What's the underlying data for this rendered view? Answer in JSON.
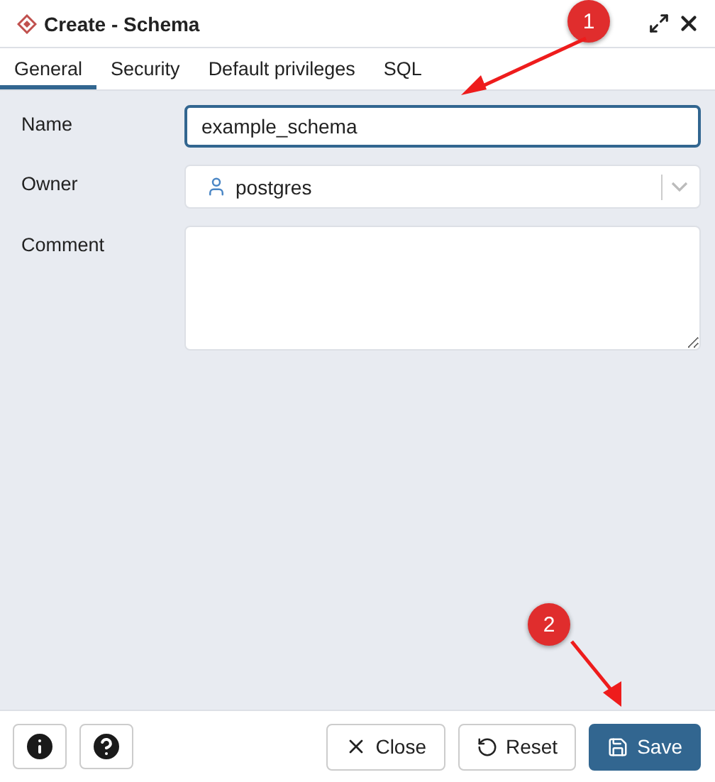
{
  "window": {
    "title": "Create - Schema"
  },
  "tabs": [
    {
      "label": "General",
      "selected": true
    },
    {
      "label": "Security",
      "selected": false
    },
    {
      "label": "Default privileges",
      "selected": false
    },
    {
      "label": "SQL",
      "selected": false
    }
  ],
  "fields": [
    {
      "kind": "text",
      "label": "Name",
      "value": "example_schema",
      "focused": true
    },
    {
      "kind": "select",
      "label": "Owner",
      "value": "postgres"
    },
    {
      "kind": "textarea",
      "label": "Comment"
    }
  ],
  "footer": {
    "buttons": [
      {
        "kind": "close",
        "label": "Close"
      },
      {
        "kind": "reset",
        "label": "Reset"
      },
      {
        "kind": "save",
        "label": "Save"
      }
    ]
  },
  "annotations": [
    {
      "number": "1"
    },
    {
      "number": "2"
    }
  ]
}
